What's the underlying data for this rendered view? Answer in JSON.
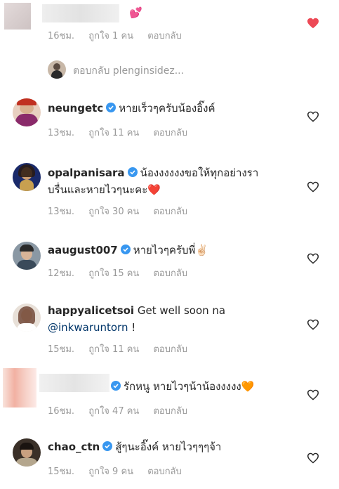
{
  "comments": [
    {
      "username": "",
      "text": "💕",
      "time": "16ชม.",
      "likes": "ถูกใจ 1 คน",
      "reply": "ตอบกลับ",
      "liked": true,
      "avatar_color": "#d8c8c8",
      "view_replies": "ตอบกลับ plenginsidez..."
    },
    {
      "username": "neungetc",
      "verified": true,
      "text": "หายเร็วๆครับน้องอิ๊งค์",
      "time": "13ชม.",
      "likes": "ถูกใจ 11 คน",
      "reply": "ตอบกลับ",
      "liked": false,
      "avatar_color": "#c84030"
    },
    {
      "username": "opalpanisara",
      "verified": true,
      "text_line1": "น้องงงงงงขอให้ทุกอย่างรา",
      "text_line2": "บรื่นและหายไวๆนะคะ❤️",
      "time": "13ชม.",
      "likes": "ถูกใจ 30 คน",
      "reply": "ตอบกลับ",
      "liked": false,
      "avatar_color": "#1a2a6a"
    },
    {
      "username": "aaugust007",
      "verified": true,
      "text": "หายไวๆครับพี่✌🏻",
      "time": "12ชม.",
      "likes": "ถูกใจ 15 คน",
      "reply": "ตอบกลับ",
      "liked": false,
      "avatar_color": "#6a7a88"
    },
    {
      "username": "happyalicetsoi",
      "verified": false,
      "text": "Get well soon na",
      "mention": "@inkwaruntorn",
      "mention_suffix": "!",
      "time": "15ชม.",
      "likes": "ถูกใจ 11 คน",
      "reply": "ตอบกลับ",
      "liked": false,
      "avatar_color": "#8a6a58"
    },
    {
      "username": "",
      "verified": true,
      "text": "รักหนู หายไวๆน้าน้องงงงง🧡",
      "time": "16ชม.",
      "likes": "ถูกใจ 47 คน",
      "reply": "ตอบกลับ",
      "liked": false,
      "avatar_color": "#f0b0a0"
    },
    {
      "username": "chao_ctn",
      "verified": true,
      "text": "สู้ๆนะอิ๊งค์ หายไวๆๆๆจ้า",
      "time": "15ชม.",
      "likes": "ถูกใจ 9 คน",
      "reply": "ตอบกลับ",
      "liked": false,
      "avatar_color": "#3a3028"
    }
  ],
  "colors": {
    "liked_heart": "#ed4956",
    "verified": "#3897f0",
    "meta": "#999999",
    "mention": "#003569"
  }
}
